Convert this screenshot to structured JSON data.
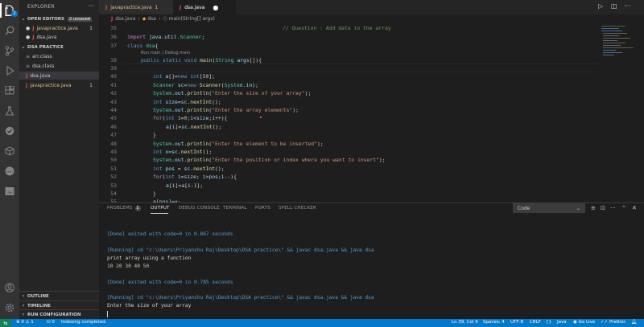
{
  "sidebar": {
    "title": "EXPLORER",
    "open_editors": {
      "label": "OPEN EDITORS",
      "unsaved": "2 unsaved"
    },
    "open_files": [
      {
        "name": "javapractice.java",
        "count": "1"
      },
      {
        "name": "dsa.java",
        "count": ""
      }
    ],
    "folder": "DSA PRACTICE",
    "files": [
      {
        "name": "arr.class",
        "count": ""
      },
      {
        "name": "dsa.class",
        "count": ""
      },
      {
        "name": "dsa.java",
        "count": ""
      },
      {
        "name": "javapractice.java",
        "count": "1"
      }
    ],
    "outline": "OUTLINE",
    "timeline": "TIMELINE",
    "run_config": "RUN CONFIGURATION"
  },
  "tabs": [
    {
      "label": "javapractice.java",
      "suffix": "1"
    },
    {
      "label": "dsa.java"
    }
  ],
  "breadcrumb": {
    "file": "dsa.java",
    "cls": "dsa",
    "method": "main(String[] args)"
  },
  "code": {
    "line_numbers": [
      "35",
      "36",
      "37",
      "38",
      "39",
      "40",
      "41",
      "42",
      "43",
      "44",
      "45",
      "46",
      "47",
      "48",
      "49",
      "50",
      "51",
      "52",
      "53",
      "54",
      "55"
    ],
    "comment": "// Question : Add data in the array",
    "codelens": "Run main | Debug main"
  },
  "panel": {
    "tabs": [
      "PROBLEMS",
      "OUTPUT",
      "DEBUG CONSOLE",
      "TERMINAL",
      "PORTS",
      "SPELL CHECKER"
    ],
    "problems_count": "1",
    "select_value": "Code",
    "output_lines": [
      "[Done] exited with code=0 in 0.867 seconds",
      "[Running] cd \"c:\\Users\\Priyanshu Raj\\Desktop\\DSA practice\\\" && javac dsa.java && java dsa",
      "print array using a function",
      "10 20 30 40 50",
      "[Done] exited with code=0 in 0.785 seconds",
      "[Running] cd \"c:\\Users\\Priyanshu Raj\\Desktop\\DSA practice\\\" && javac dsa.java && java dsa",
      "Enter the size of your array"
    ]
  },
  "status": {
    "errors": "0",
    "warnings": "1",
    "ports": "0",
    "indexing": "Indexing completed.",
    "position": "Ln 39, Col 9",
    "spaces": "Spaces: 4",
    "encoding": "UTF-8",
    "eol": "CRLF",
    "language": "Java",
    "golive": "Go Live",
    "prettier": "Prettier"
  }
}
